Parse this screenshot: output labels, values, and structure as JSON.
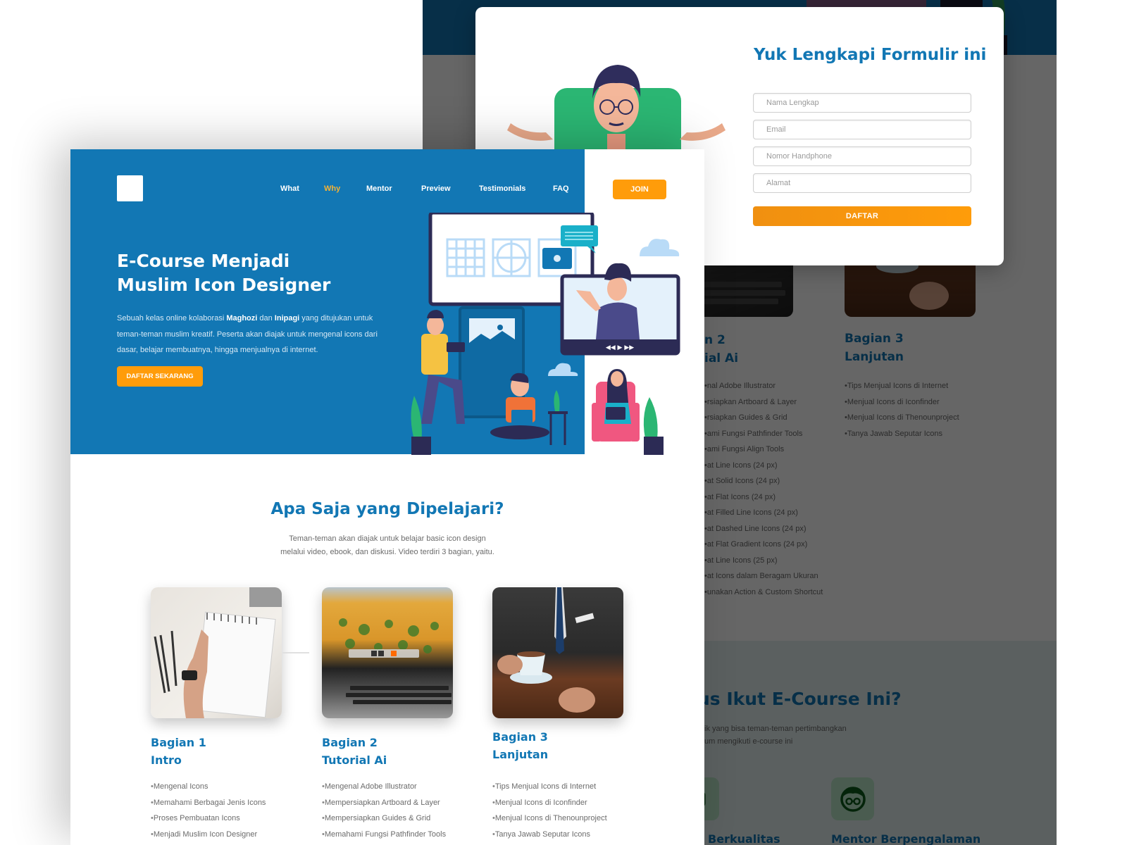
{
  "background_page": {
    "sections_visible": {
      "part2_title_fragment": [
        "n 2",
        "ial Ai"
      ],
      "part2_items_fragment": [
        "nal Adobe Illustrator",
        "rsiapkan Artboard & Layer",
        "rsiapkan Guides & Grid",
        "ami Fungsi Pathfinder Tools",
        "ami Fungsi Align Tools",
        "at Line Icons (24 px)",
        "at Solid Icons (24 px)",
        "at Flat Icons (24 px)",
        "at Filled Line Icons (24 px)",
        "at Dashed Line Icons (24 px)",
        "at Flat Gradient Icons (24 px)",
        "at Line Icons (25 px)",
        "at Icons dalam Beragam Ukuran",
        "unakan Action & Custom Shortcut"
      ],
      "part3_title": [
        "Bagian 3",
        "Lanjutan"
      ],
      "part3_items": [
        "Tips Menjual Icons di Internet",
        "Menjual Icons di Iconfinder",
        "Menjual Icons di Thenounproject",
        "Tanya Jawab Seputar Icons"
      ]
    },
    "why_section": {
      "title_fragment": "us Ikut E-Course Ini?",
      "desc_fragment": [
        "ik yang bisa teman-teman pertimbangkan",
        "um mengikuti e-course ini"
      ],
      "features": [
        {
          "title_fragment": "Berkualitas",
          "icon": "quality-icon"
        },
        {
          "title": "Mentor Berpengalaman",
          "icon": "mentor-glasses-icon"
        }
      ]
    }
  },
  "modal": {
    "title": "Yuk Lengkapi Formulir ini",
    "fields": [
      {
        "name": "full-name",
        "placeholder": "Nama Lengkap",
        "value": ""
      },
      {
        "name": "email",
        "placeholder": "Email",
        "value": ""
      },
      {
        "name": "phone",
        "placeholder": "Nomor Handphone",
        "value": ""
      },
      {
        "name": "address",
        "placeholder": "Alamat",
        "value": ""
      }
    ],
    "submit_label": "DAFTAR"
  },
  "header": {
    "nav": [
      {
        "label": "What",
        "active": false
      },
      {
        "label": "Why",
        "active": true
      },
      {
        "label": "Mentor",
        "active": false
      },
      {
        "label": "Preview",
        "active": false
      },
      {
        "label": "Testimonials",
        "active": false
      },
      {
        "label": "FAQ",
        "active": false
      }
    ],
    "join_label": "JOIN"
  },
  "hero": {
    "title_line1": "E-Course Menjadi",
    "title_line2": "Muslim Icon Designer",
    "desc_prefix": "Sebuah kelas online kolaborasi ",
    "desc_bold1": "Maghozi",
    "desc_mid": " dan ",
    "desc_bold2": "Inipagi",
    "desc_suffix": " yang ditujukan untuk teman-teman muslim kreatif. Peserta akan diajak untuk mengenal icons dari dasar, belajar membuatnya, hingga menjualnya di internet.",
    "cta_label": "DAFTAR SEKARANG"
  },
  "learn": {
    "title": "Apa Saja yang Dipelajari?",
    "desc_line1": "Teman-teman akan diajak untuk belajar basic icon design",
    "desc_line2": "melalui video, ebook, dan diskusi. Video terdiri 3 bagian, yaitu.",
    "parts": [
      {
        "title1": "Bagian 1",
        "title2": "Intro",
        "image": "notebook-photo",
        "items": [
          "Mengenal Icons",
          "Memahami Berbagai Jenis Icons",
          "Proses Pembuatan Icons",
          "Menjadi Muslim Icon Designer"
        ]
      },
      {
        "title1": "Bagian 2",
        "title2": "Tutorial Ai",
        "image": "laptop-photo",
        "items": [
          "Mengenal Adobe Illustrator",
          "Mempersiapkan Artboard & Layer",
          "Mempersiapkan Guides & Grid",
          "Memahami Fungsi Pathfinder Tools"
        ]
      },
      {
        "title1": "Bagian 3",
        "title2": "Lanjutan",
        "image": "coffee-suit-photo",
        "items": [
          "Tips Menjual Icons di Internet",
          "Menjual Icons di Iconfinder",
          "Menjual Icons di Thenounproject",
          "Tanya Jawab Seputar Icons"
        ]
      }
    ]
  },
  "colors": {
    "primary_blue": "#1277b4",
    "accent_orange": "#ff9c0a",
    "active_nav": "#f5b335",
    "text_gray": "#6b6b6b"
  }
}
